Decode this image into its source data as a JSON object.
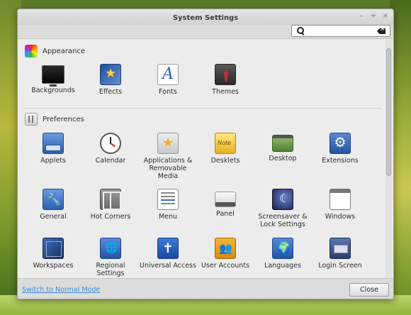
{
  "window": {
    "title": "System Settings",
    "controls": [
      {
        "name": "minimize",
        "glyph": "–"
      },
      {
        "name": "maximize",
        "glyph": "+"
      },
      {
        "name": "close",
        "glyph": "×"
      }
    ]
  },
  "search": {
    "value": "",
    "placeholder": ""
  },
  "sections": [
    {
      "id": "appearance",
      "label": "Appearance",
      "icon": "appearance-icon",
      "items": [
        {
          "id": "backgrounds",
          "label": "Backgrounds",
          "icon": "monitor-icon"
        },
        {
          "id": "effects",
          "label": "Effects",
          "icon": "effects-icon"
        },
        {
          "id": "fonts",
          "label": "Fonts",
          "icon": "font-icon"
        },
        {
          "id": "themes",
          "label": "Themes",
          "icon": "themes-icon"
        }
      ]
    },
    {
      "id": "preferences",
      "label": "Preferences",
      "icon": "preferences-icon",
      "items": [
        {
          "id": "applets",
          "label": "Applets",
          "icon": "applets-icon"
        },
        {
          "id": "calendar",
          "label": "Calendar",
          "icon": "clock-icon"
        },
        {
          "id": "apps",
          "label": "Applications & Removable Media",
          "icon": "applications-icon"
        },
        {
          "id": "desklets",
          "label": "Desklets",
          "icon": "desklets-icon"
        },
        {
          "id": "desktop",
          "label": "Desktop",
          "icon": "desktop-icon"
        },
        {
          "id": "extensions",
          "label": "Extensions",
          "icon": "extensions-icon"
        },
        {
          "id": "general",
          "label": "General",
          "icon": "wrench-icon"
        },
        {
          "id": "hotcorners",
          "label": "Hot Corners",
          "icon": "hot-corners-icon"
        },
        {
          "id": "menu",
          "label": "Menu",
          "icon": "menu-icon"
        },
        {
          "id": "panel",
          "label": "Panel",
          "icon": "panel-icon"
        },
        {
          "id": "screensaver",
          "label": "Screensaver & Lock Settings",
          "icon": "screensaver-icon"
        },
        {
          "id": "windows",
          "label": "Windows",
          "icon": "windows-icon"
        },
        {
          "id": "workspaces",
          "label": "Workspaces",
          "icon": "workspaces-icon"
        },
        {
          "id": "regional",
          "label": "Regional Settings",
          "icon": "regional-icon"
        },
        {
          "id": "universal",
          "label": "Universal Access",
          "icon": "accessibility-icon"
        },
        {
          "id": "useraccounts",
          "label": "User Accounts",
          "icon": "users-icon"
        },
        {
          "id": "languages",
          "label": "Languages",
          "icon": "languages-icon"
        },
        {
          "id": "loginscreen",
          "label": "Login Screen",
          "icon": "login-screen-icon"
        }
      ]
    }
  ],
  "footer": {
    "mode_link": "Switch to Normal Mode",
    "close_label": "Close"
  }
}
